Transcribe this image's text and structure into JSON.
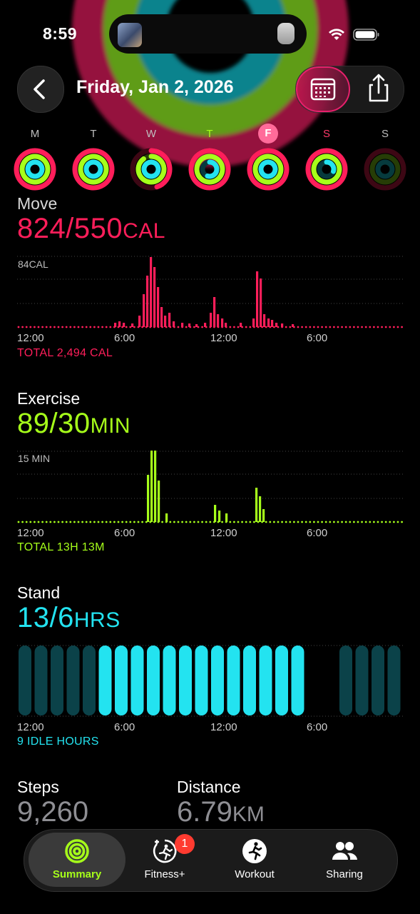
{
  "status": {
    "time": "8:59"
  },
  "header": {
    "date": "Friday, Jan 2, 2026"
  },
  "week": {
    "days": [
      {
        "label": "M",
        "today": false,
        "weekend": false,
        "move": 1.0,
        "exercise": 1.0,
        "stand": 1.0
      },
      {
        "label": "T",
        "today": false,
        "weekend": false,
        "move": 1.0,
        "exercise": 1.0,
        "stand": 1.0
      },
      {
        "label": "W",
        "today": false,
        "weekend": false,
        "move": 0.45,
        "exercise": 0.9,
        "stand": 1.0
      },
      {
        "label": "T",
        "today": false,
        "weekend": false,
        "move": 1.0,
        "exercise": 1.0,
        "stand": 0.55
      },
      {
        "label": "F",
        "today": true,
        "weekend": false,
        "move": 1.0,
        "exercise": 1.0,
        "stand": 1.0
      },
      {
        "label": "S",
        "today": false,
        "weekend": true,
        "move": 1.0,
        "exercise": 1.0,
        "stand": 0.3
      },
      {
        "label": "S",
        "today": false,
        "weekend": false,
        "move": 0.0,
        "exercise": 0.0,
        "stand": 0.0
      }
    ]
  },
  "move": {
    "title": "Move",
    "value": "824/550",
    "unit": "CAL",
    "max_label": "84CAL",
    "axis": [
      "12:00",
      "6:00",
      "12:00",
      "6:00"
    ],
    "total": "TOTAL 2,494 CAL",
    "color": "#ff1e5a"
  },
  "exercise": {
    "title": "Exercise",
    "value": "89/30",
    "unit": "MIN",
    "max_label": "15 MIN",
    "axis": [
      "12:00",
      "6:00",
      "12:00",
      "6:00"
    ],
    "total": "TOTAL 13H 13M",
    "color": "#a6ff1a"
  },
  "stand": {
    "title": "Stand",
    "value": "13/6",
    "unit": "HRS",
    "axis": [
      "12:00",
      "6:00",
      "12:00",
      "6:00"
    ],
    "idle": "9 IDLE HOURS",
    "color": "#23e3f0"
  },
  "stats": {
    "steps_title": "Steps",
    "steps_value": "9,260",
    "distance_title": "Distance",
    "distance_value": "6.79",
    "distance_unit": "KM"
  },
  "tabs": [
    {
      "label": "Summary",
      "icon": "activity-rings-icon",
      "active": true
    },
    {
      "label": "Fitness+",
      "icon": "fitness-plus-icon",
      "active": false,
      "badge": "1"
    },
    {
      "label": "Workout",
      "icon": "running-figure-icon",
      "active": false
    },
    {
      "label": "Sharing",
      "icon": "people-icon",
      "active": false
    }
  ],
  "colors": {
    "move": "#ff1e5a",
    "exercise": "#a6ff1a",
    "stand": "#23e3f0"
  }
}
